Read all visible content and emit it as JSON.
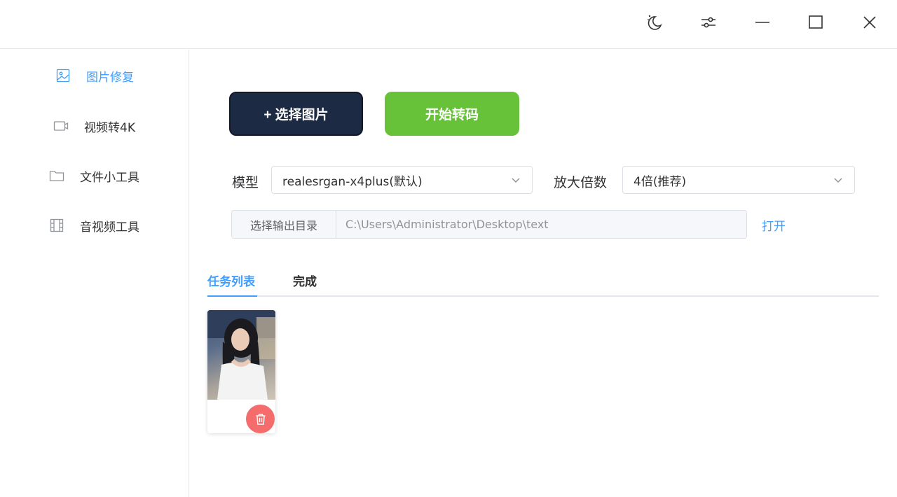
{
  "titlebar": {
    "theme_icon": "moon-icon",
    "settings_icon": "sliders-icon",
    "minimize_icon": "minimize-icon",
    "maximize_icon": "maximize-icon",
    "close_icon": "close-icon"
  },
  "sidebar": {
    "items": [
      {
        "label": "图片修复",
        "icon": "image-icon",
        "active": true
      },
      {
        "label": "视频转4K",
        "icon": "video-icon",
        "active": false
      },
      {
        "label": "文件小工具",
        "icon": "folder-icon",
        "active": false
      },
      {
        "label": "音视频工具",
        "icon": "film-icon",
        "active": false
      }
    ]
  },
  "actions": {
    "select_label": "+ 选择图片",
    "start_label": "开始转码"
  },
  "form": {
    "model_label": "模型",
    "model_value": "realesrgan-x4plus(默认)",
    "scale_label": "放大倍数",
    "scale_value": "4倍(推荐)",
    "output_button": "选择输出目录",
    "output_path": "C:\\Users\\Administrator\\Desktop\\text",
    "open_link": "打开"
  },
  "tabs": {
    "items": [
      "任务列表",
      "完成"
    ],
    "active": 0
  },
  "tasks": [
    {
      "thumbnail": "portrait-photo",
      "delete_icon": "trash-icon"
    }
  ],
  "colors": {
    "accent": "#409eff",
    "primary_dark": "#1d2a43",
    "success": "#67c23a",
    "danger": "#f56c6c"
  }
}
